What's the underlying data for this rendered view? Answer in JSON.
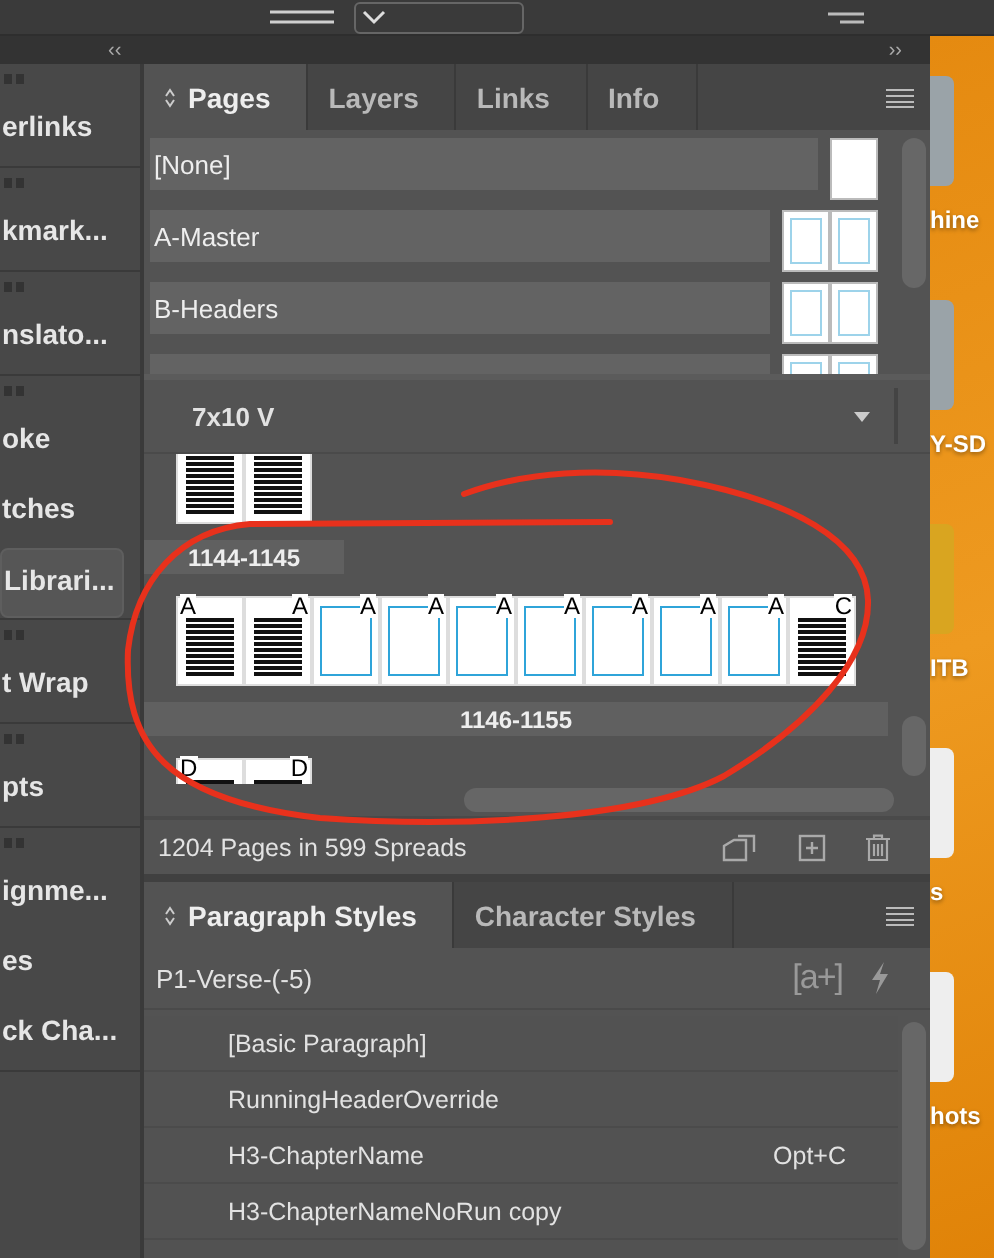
{
  "dock_header": {
    "collapse_left": "‹‹",
    "collapse_right": "››"
  },
  "left_dock": {
    "groups": [
      {
        "items": [
          {
            "label": "erlinks",
            "selected": false
          }
        ]
      },
      {
        "items": [
          {
            "label": "kmark...",
            "selected": false
          }
        ]
      },
      {
        "items": [
          {
            "label": "nslato...",
            "selected": false
          }
        ]
      },
      {
        "items": [
          {
            "label": "oke",
            "selected": false
          },
          {
            "label": "tches",
            "selected": false
          },
          {
            "label": "Librari...",
            "selected": true
          }
        ]
      },
      {
        "items": [
          {
            "label": "t Wrap",
            "selected": false
          }
        ]
      },
      {
        "items": [
          {
            "label": "pts",
            "selected": false
          }
        ]
      },
      {
        "items": [
          {
            "label": "ignme...",
            "selected": false
          },
          {
            "label": "es",
            "selected": false
          },
          {
            "label": "ck Cha...",
            "selected": false
          }
        ]
      }
    ]
  },
  "pages_panel": {
    "tabs": [
      {
        "label": "Pages",
        "selected": true
      },
      {
        "label": "Layers",
        "selected": false
      },
      {
        "label": "Links",
        "selected": false
      },
      {
        "label": "Info",
        "selected": false
      }
    ],
    "masters": [
      {
        "label": "[None]",
        "kind": "single"
      },
      {
        "label": "A-Master",
        "kind": "spread"
      },
      {
        "label": "B-Headers",
        "kind": "spread"
      },
      {
        "kind": "spread"
      }
    ],
    "page_size": "7x10 V",
    "spreads": [
      {
        "label": "1144-1145",
        "pages": [
          {
            "kind": "text"
          },
          {
            "kind": "text"
          }
        ]
      },
      {
        "label": "1146-1155",
        "pages": [
          {
            "kind": "text",
            "master": "A"
          },
          {
            "kind": "text",
            "master": "A"
          },
          {
            "kind": "blank",
            "master": "A"
          },
          {
            "kind": "blank",
            "master": "A"
          },
          {
            "kind": "blank",
            "master": "A"
          },
          {
            "kind": "blank",
            "master": "A"
          },
          {
            "kind": "blank",
            "master": "A"
          },
          {
            "kind": "blank",
            "master": "A"
          },
          {
            "kind": "blank",
            "master": "A"
          },
          {
            "kind": "text",
            "master": "C"
          }
        ]
      },
      {
        "pages": [
          {
            "kind": "text",
            "master": "D"
          },
          {
            "kind": "text",
            "master": "D"
          }
        ]
      }
    ],
    "status": "1204 Pages in 599 Spreads"
  },
  "styles_panel": {
    "tabs": [
      {
        "label": "Paragraph Styles",
        "selected": true
      },
      {
        "label": "Character Styles",
        "selected": false
      }
    ],
    "current": "P1-Verse-(-5)",
    "new_style": "[a+]",
    "styles": [
      {
        "label": "[Basic Paragraph]"
      },
      {
        "label": "RunningHeaderOverride"
      },
      {
        "label": "H3-ChapterName",
        "shortcut": "Opt+C"
      },
      {
        "label": "H3-ChapterNameNoRun copy"
      }
    ]
  },
  "desktop": {
    "items": [
      {
        "label": "hine",
        "kind": "drive"
      },
      {
        "label": "Y-SD",
        "kind": "drive"
      },
      {
        "label": "ITB",
        "kind": "yellow-drive"
      },
      {
        "label": "s",
        "kind": "document"
      },
      {
        "label": "hots",
        "kind": "document"
      }
    ]
  }
}
